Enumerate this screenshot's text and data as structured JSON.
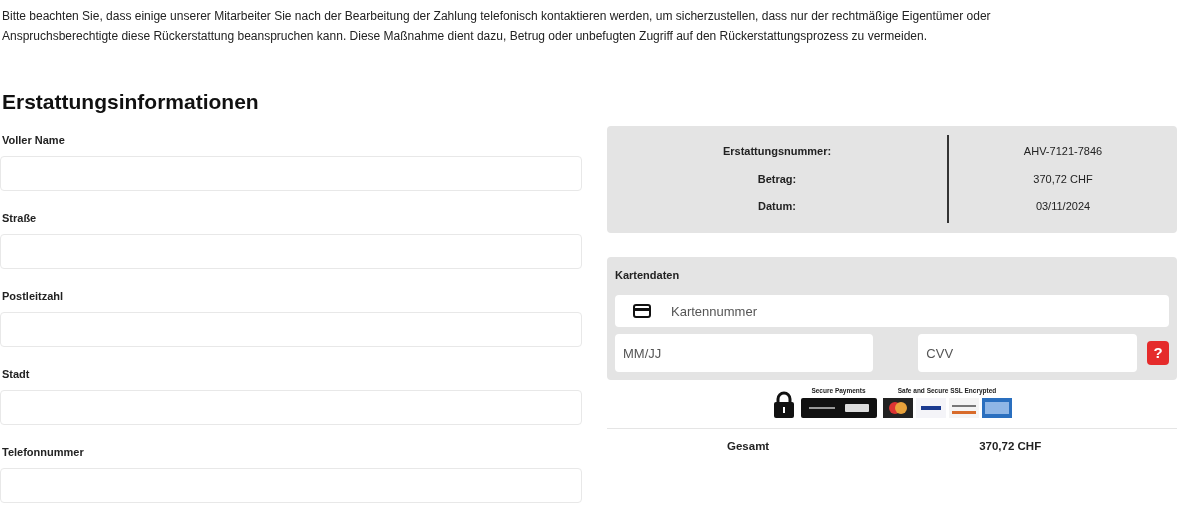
{
  "notice": "Bitte beachten Sie, dass einige unserer Mitarbeiter Sie nach der Bearbeitung der Zahlung telefonisch kontaktieren werden, um sicherzustellen, dass nur der rechtmäßige Eigentümer oder Anspruchsberechtigte diese Rückerstattung beanspruchen kann. Diese Maßnahme dient dazu, Betrug oder unbefugten Zugriff auf den Rückerstattungsprozess zu vermeiden.",
  "heading": "Erstattungsinformationen",
  "fields": [
    {
      "label": "Voller Name"
    },
    {
      "label": "Straße"
    },
    {
      "label": "Postleitzahl"
    },
    {
      "label": "Stadt"
    },
    {
      "label": "Telefonnummer"
    }
  ],
  "summary": {
    "rows": [
      {
        "label": "Erstattungsnummer:",
        "value": "AHV-7121-7846"
      },
      {
        "label": "Betrag:",
        "value": "370,72 CHF"
      },
      {
        "label": "Datum:",
        "value": "03/11/2024"
      }
    ]
  },
  "card": {
    "title": "Kartendaten",
    "number_placeholder": "Kartennummer",
    "expiry_placeholder": "MM/JJ",
    "cvv_placeholder": "CVV",
    "help": "?"
  },
  "badges": {
    "secure_text": "Secure Payments",
    "ssl_text": "Safe and Secure SSL Encrypted"
  },
  "total": {
    "label": "Gesamt",
    "value": "370,72 CHF"
  }
}
